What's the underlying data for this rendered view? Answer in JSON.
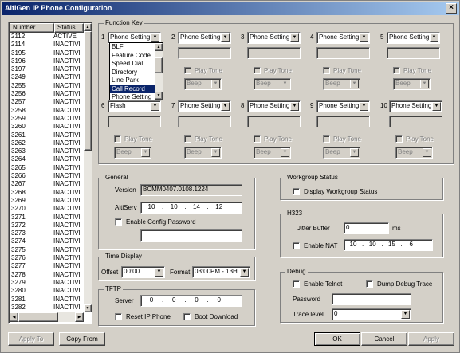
{
  "window": {
    "title": "AltiGen IP Phone Configuration",
    "close": "×"
  },
  "list": {
    "headers": [
      "Number",
      "Status"
    ],
    "rows": [
      [
        "2112",
        "ACTIVE"
      ],
      [
        "2114",
        "INACTIVI"
      ],
      [
        "3195",
        "INACTIVI"
      ],
      [
        "3196",
        "INACTIVI"
      ],
      [
        "3197",
        "INACTIVI"
      ],
      [
        "3249",
        "INACTIVI"
      ],
      [
        "3255",
        "INACTIVI"
      ],
      [
        "3256",
        "INACTIVI"
      ],
      [
        "3257",
        "INACTIVI"
      ],
      [
        "3258",
        "INACTIVI"
      ],
      [
        "3259",
        "INACTIVI"
      ],
      [
        "3260",
        "INACTIVI"
      ],
      [
        "3261",
        "INACTIVI"
      ],
      [
        "3262",
        "INACTIVI"
      ],
      [
        "3263",
        "INACTIVI"
      ],
      [
        "3264",
        "INACTIVI"
      ],
      [
        "3265",
        "INACTIVI"
      ],
      [
        "3266",
        "INACTIVI"
      ],
      [
        "3267",
        "INACTIVI"
      ],
      [
        "3268",
        "INACTIVI"
      ],
      [
        "3269",
        "INACTIVI"
      ],
      [
        "3270",
        "INACTIVI"
      ],
      [
        "3271",
        "INACTIVI"
      ],
      [
        "3272",
        "INACTIVI"
      ],
      [
        "3273",
        "INACTIVI"
      ],
      [
        "3274",
        "INACTIVI"
      ],
      [
        "3275",
        "INACTIVI"
      ],
      [
        "3276",
        "INACTIVI"
      ],
      [
        "3277",
        "INACTIVI"
      ],
      [
        "3278",
        "INACTIVI"
      ],
      [
        "3279",
        "INACTIVI"
      ],
      [
        "3280",
        "INACTIVI"
      ],
      [
        "3281",
        "INACTIVI"
      ],
      [
        "3282",
        "INACTIVI"
      ]
    ]
  },
  "function_key": {
    "title": "Function Key",
    "keys": [
      {
        "num": "1",
        "value": "Phone Setting"
      },
      {
        "num": "2",
        "value": "Phone Setting",
        "play_tone": "Play Tone",
        "tone": "Beep"
      },
      {
        "num": "3",
        "value": "Phone Setting",
        "play_tone": "Play Tone",
        "tone": "Beep"
      },
      {
        "num": "4",
        "value": "Phone Setting",
        "play_tone": "Play Tone",
        "tone": "Beep"
      },
      {
        "num": "5",
        "value": "Phone Setting",
        "play_tone": "Play Tone",
        "tone": "Beep"
      },
      {
        "num": "6",
        "value": "Flash",
        "play_tone": "Play Tone",
        "tone": "Beep"
      },
      {
        "num": "7",
        "value": "Phone Setting",
        "play_tone": "Play Tone",
        "tone": "Beep"
      },
      {
        "num": "8",
        "value": "Phone Setting",
        "play_tone": "Play Tone",
        "tone": "Beep"
      },
      {
        "num": "9",
        "value": "Phone Setting",
        "play_tone": "Play Tone",
        "tone": "Beep"
      },
      {
        "num": "10",
        "value": "Phone Setting",
        "play_tone": "Play Tone",
        "tone": "Beep"
      }
    ],
    "dropdown_options": [
      "BLF",
      "Feature Code",
      "Speed Dial",
      "Directory",
      "Line Park",
      "Call Record",
      "Phone Setting"
    ],
    "dropdown_highlighted": "Call Record"
  },
  "general": {
    "title": "General",
    "version_label": "Version",
    "version": "BCMM0407.0108.1224",
    "altiserv_label": "AltiServ",
    "altiserv_ip": [
      "10",
      "10",
      "14",
      "12"
    ],
    "enable_config_password": "Enable Config Password"
  },
  "time_display": {
    "title": "Time Display",
    "offset_label": "Offset",
    "offset": "00:00",
    "format_label": "Format",
    "format": "03:00PM - 13H"
  },
  "tftp": {
    "title": "TFTP",
    "server_label": "Server",
    "server_ip": [
      "0",
      "0",
      "0",
      "0"
    ],
    "reset_ip_phone": "Reset IP Phone",
    "boot_download": "Boot Download"
  },
  "workgroup": {
    "title": "Workgroup Status",
    "display": "Display Workgroup Status"
  },
  "h323": {
    "title": "H323",
    "jitter_label": "Jitter Buffer",
    "jitter_value": "0",
    "jitter_unit": "ms",
    "enable_nat": "Enable NAT",
    "nat_ip": [
      "10",
      "10",
      "15",
      "6"
    ]
  },
  "debug": {
    "title": "Debug",
    "enable_telnet": "Enable Telnet",
    "dump_debug": "Dump Debug Trace",
    "password_label": "Password",
    "password_value": "",
    "trace_label": "Trace level",
    "trace_value": "0"
  },
  "buttons": {
    "apply_to": "Apply To",
    "copy_from": "Copy From",
    "ok": "OK",
    "cancel": "Cancel",
    "apply": "Apply"
  }
}
